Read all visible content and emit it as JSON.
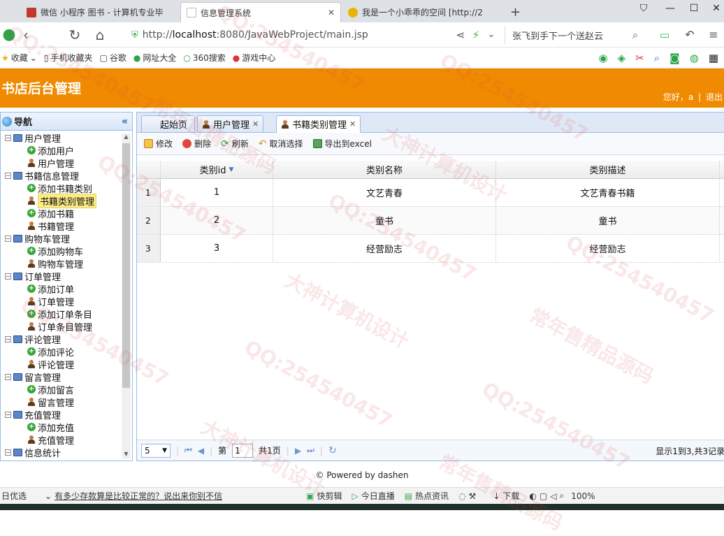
{
  "browser": {
    "tabs": [
      {
        "title": "微信 小程序 图书 - 计算机专业毕",
        "active": false,
        "favicon_color": "#c0392b"
      },
      {
        "title": "信息管理系统",
        "active": true,
        "favicon_color": "#bbbbbb"
      },
      {
        "title": "我是一个小乖乖的空间 [http://2",
        "active": false,
        "favicon_color": "#e8b400"
      }
    ],
    "new_tab": "+",
    "url_prefix": "http://",
    "url_host": "localhost",
    "url_rest": ":8080/JavaWebProject/main.jsp",
    "search_text": "张飞到手下一个送赵云",
    "bookmarks": [
      "收藏",
      "手机收藏夹",
      "谷歌",
      "网址大全",
      "360搜索",
      "游戏中心"
    ]
  },
  "app": {
    "title": "书店后台管理",
    "welcome": "您好，a",
    "logout": "退出",
    "separator": "|"
  },
  "nav": {
    "title": "导航",
    "collapse": "«",
    "groups": [
      {
        "label": "用户管理",
        "children": [
          "添加用户",
          "用户管理"
        ]
      },
      {
        "label": "书籍信息管理",
        "children": [
          "添加书籍类别",
          "书籍类别管理",
          "添加书籍",
          "书籍管理"
        ]
      },
      {
        "label": "购物车管理",
        "children": [
          "添加购物车",
          "购物车管理"
        ]
      },
      {
        "label": "订单管理",
        "children": [
          "添加订单",
          "订单管理",
          "添加订单条目",
          "订单条目管理"
        ]
      },
      {
        "label": "评论管理",
        "children": [
          "添加评论",
          "评论管理"
        ]
      },
      {
        "label": "留言管理",
        "children": [
          "添加留言",
          "留言管理"
        ]
      },
      {
        "label": "充值管理",
        "children": [
          "添加充值",
          "充值管理"
        ]
      },
      {
        "label": "信息统计",
        "children": []
      }
    ],
    "selected": "书籍类别管理"
  },
  "tabs": [
    {
      "label": "起始页",
      "closable": false,
      "active": false
    },
    {
      "label": "用户管理",
      "closable": true,
      "active": false
    },
    {
      "label": "书籍类别管理",
      "closable": true,
      "active": true
    }
  ],
  "toolbar": {
    "edit": "修改",
    "delete": "删除",
    "refresh": "刷新",
    "cancel_select": "取消选择",
    "export": "导出到excel"
  },
  "grid": {
    "columns": [
      "类别id",
      "类别名称",
      "类别描述"
    ],
    "sort_indicator": "▼",
    "rows": [
      {
        "num": "1",
        "id": "1",
        "name": "文艺青春",
        "desc": "文艺青春书籍"
      },
      {
        "num": "2",
        "id": "2",
        "name": "童书",
        "desc": "童书"
      },
      {
        "num": "3",
        "id": "3",
        "name": "经营励志",
        "desc": "经营励志"
      }
    ]
  },
  "pager": {
    "page_size": "5",
    "page_prefix": "第",
    "page_value": "1",
    "page_suffix": "共1页",
    "info": "显示1到3,共3记录"
  },
  "footer": "© Powered by dashen",
  "statusbar": {
    "left": "日优选",
    "news": "有多少存款算是比较正常的？说出来你别不信",
    "items": [
      "快剪辑",
      "今日直播",
      "热点资讯",
      "下载"
    ],
    "zoom": "100%"
  },
  "watermarks": [
    "QQ:254540457",
    "大神计算机设计",
    "常年售精品源码"
  ],
  "colors": {
    "header_orange": "#f08a00",
    "panel_border": "#99bbe8"
  }
}
